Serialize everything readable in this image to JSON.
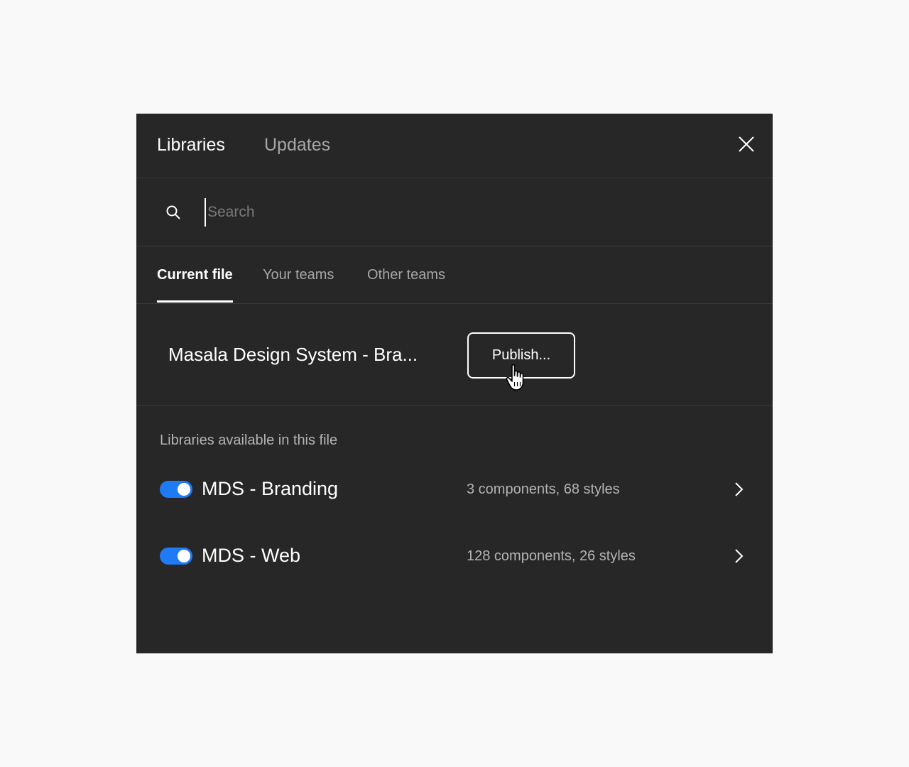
{
  "header": {
    "tabs": [
      {
        "label": "Libraries"
      },
      {
        "label": "Updates"
      }
    ],
    "close_icon": "close-icon"
  },
  "search": {
    "placeholder": "Search",
    "value": ""
  },
  "subtabs": [
    {
      "label": "Current file"
    },
    {
      "label": "Your teams"
    },
    {
      "label": "Other teams"
    }
  ],
  "current_file": {
    "name": "Masala Design System - Bra...",
    "publish_label": "Publish..."
  },
  "libraries": {
    "section_label": "Libraries available in this file",
    "items": [
      {
        "name": "MDS - Branding",
        "meta": "3 components, 68 styles",
        "enabled": true
      },
      {
        "name": "MDS - Web",
        "meta": "128 components, 26 styles",
        "enabled": true
      }
    ]
  },
  "colors": {
    "panel_bg": "#272727",
    "page_bg": "#f9f9f9",
    "toggle_on": "#1e7bf5",
    "text_secondary": "#a6a6a6"
  }
}
